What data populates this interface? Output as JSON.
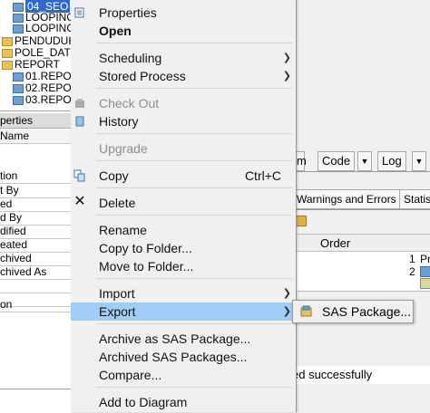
{
  "tree": {
    "items": [
      {
        "label": "04_SEO",
        "selected": true
      },
      {
        "label": "LOOPING"
      },
      {
        "label": "LOOPING"
      },
      {
        "label": "PENDUDUK"
      },
      {
        "label": "POLE_DAT"
      },
      {
        "label": "REPORT"
      },
      {
        "label": "01.REPO"
      },
      {
        "label": "02.REPO"
      },
      {
        "label": "03.REPO"
      }
    ]
  },
  "properties_panel": {
    "header": "perties",
    "name_header": "Name",
    "rows": [
      "tion",
      "t By",
      "ed",
      "d By",
      "dified",
      "eated",
      "chived",
      "chived As",
      "",
      "",
      "on"
    ]
  },
  "right_panel": {
    "tab_partial": "m",
    "tab_code": "Code",
    "tab_log": "Log",
    "subtab_warnings": "Warnings and Errors",
    "subtab_stats": "Statis",
    "col_order": "Order",
    "row1_order": "1",
    "row1_extra": "Pr",
    "row2_order": "2",
    "status_text": "ed successfully"
  },
  "context_menu": {
    "items": {
      "properties": "Properties",
      "open": "Open",
      "scheduling": "Scheduling",
      "stored_process": "Stored Process",
      "check_out": "Check Out",
      "history": "History",
      "upgrade": "Upgrade",
      "copy": "Copy",
      "copy_shortcut": "Ctrl+C",
      "delete": "Delete",
      "rename": "Rename",
      "copy_to_folder": "Copy to Folder...",
      "move_to_folder": "Move to Folder...",
      "import": "Import",
      "export": "Export",
      "archive_as_package": "Archive as SAS Package...",
      "archived_packages": "Archived SAS Packages...",
      "compare": "Compare...",
      "add_to_diagram": "Add to Diagram"
    },
    "highlight_color": "#9fcdf5"
  },
  "submenu": {
    "sas_package": "SAS Package..."
  }
}
